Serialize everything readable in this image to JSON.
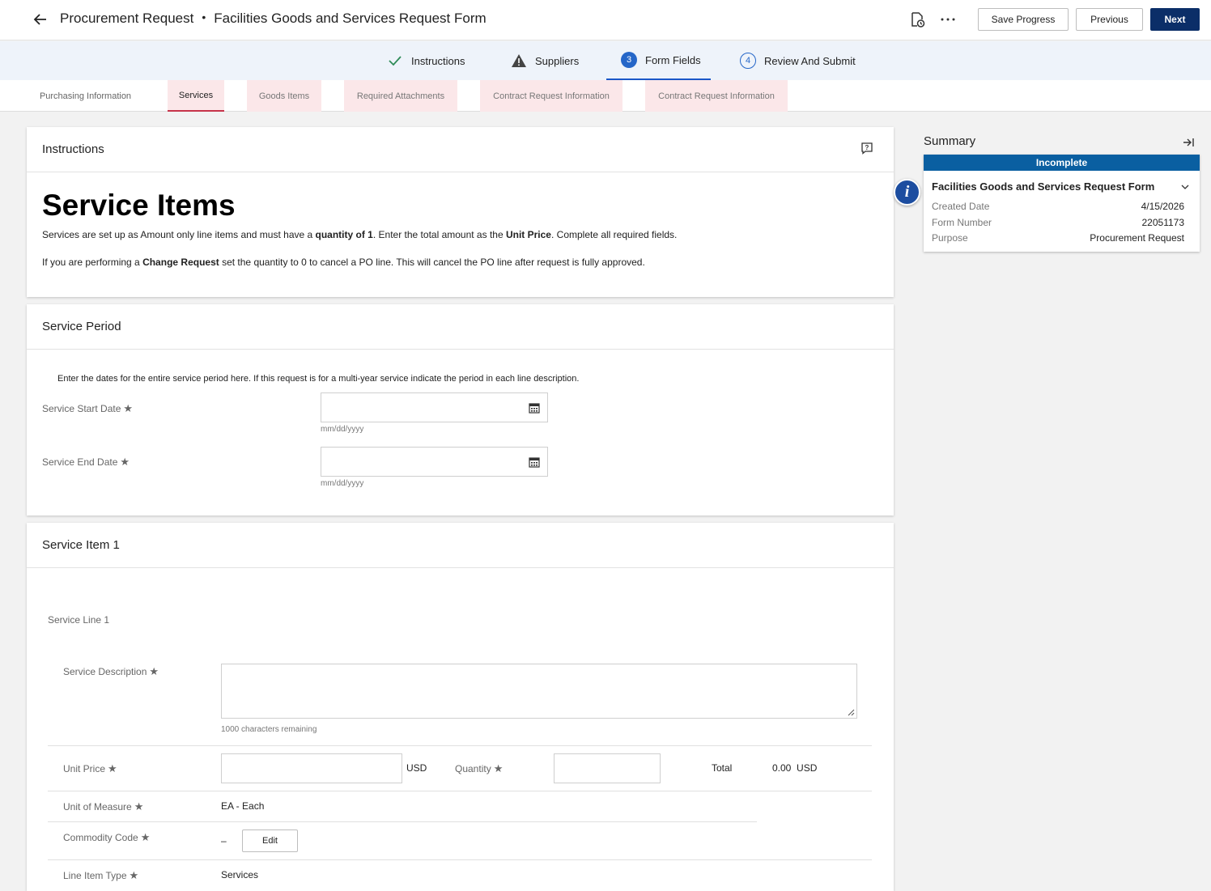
{
  "header": {
    "breadcrumb": "Procurement Request",
    "separator": "•",
    "title": "Facilities Goods and Services Request Form",
    "save_label": "Save Progress",
    "previous_label": "Previous",
    "next_label": "Next",
    "icons": [
      "back-arrow-icon",
      "document-history-icon",
      "more-options-icon"
    ]
  },
  "steps": [
    {
      "label": "Instructions",
      "state": "complete",
      "marker": "check-icon"
    },
    {
      "label": "Suppliers",
      "state": "warning",
      "marker": "warning-icon"
    },
    {
      "label": "Form Fields",
      "state": "active",
      "number": "3"
    },
    {
      "label": "Review And Submit",
      "state": "upcoming",
      "number": "4"
    }
  ],
  "subtabs": [
    {
      "label": "Purchasing Information"
    },
    {
      "label": "Services",
      "active": true
    },
    {
      "label": "Goods Items"
    },
    {
      "label": "Required Attachments"
    },
    {
      "label": "Contract Request Information"
    },
    {
      "label": "Contract Request Information"
    }
  ],
  "instructions": {
    "heading": "Instructions",
    "title": "Service Items",
    "line1": {
      "a": "Services are set up as Amount only line items and must have a ",
      "b": "quantity of 1",
      "c": ". Enter the total amount as the ",
      "d": "Unit Price",
      "e": ". Complete all required fields."
    },
    "line2": {
      "a": "If you are performing a ",
      "b": "Change Request",
      "c": " set the quantity to 0 to cancel a PO line.  This will cancel the PO line after request is fully approved."
    }
  },
  "service_period": {
    "heading": "Service Period",
    "note": "Enter the dates for the entire service period here.  If this request is for a multi-year service indicate the period in each line description.",
    "start_label": "Service Start Date",
    "end_label": "Service End Date",
    "start_value": "",
    "end_value": "",
    "date_hint": "mm/dd/yyyy",
    "required_marker": "★"
  },
  "service_item": {
    "heading": "Service Item 1",
    "line_label": "Service Line 1",
    "description_label": "Service Description",
    "description_value": "",
    "chars_remaining": "1000 characters remaining",
    "unit_price_label": "Unit Price",
    "unit_price_value": "",
    "currency": "USD",
    "quantity_label": "Quantity",
    "quantity_value": "",
    "total_label": "Total",
    "total_value": "0.00",
    "total_currency": "USD",
    "uom_label": "Unit of Measure",
    "uom_value": "EA - Each",
    "commodity_label": "Commodity Code",
    "commodity_value": "–",
    "edit_label": "Edit",
    "line_type_label": "Line Item Type",
    "line_type_value": "Services"
  },
  "summary": {
    "title": "Summary",
    "status": "Incomplete",
    "status_color": "#0a5fa1",
    "form_name": "Facilities Goods and Services Request Form",
    "rows": [
      {
        "key": "Created Date",
        "value": "4/15/2026"
      },
      {
        "key": "Form Number",
        "value": "22051173"
      },
      {
        "key": "Purpose",
        "value": "Procurement Request"
      }
    ],
    "info_glyph": "i"
  },
  "colors": {
    "primary": "#0b2e68",
    "accent_blue": "#2566c8",
    "tab_pink": "#fbe7e9",
    "tab_active_underline": "#c6344a"
  }
}
